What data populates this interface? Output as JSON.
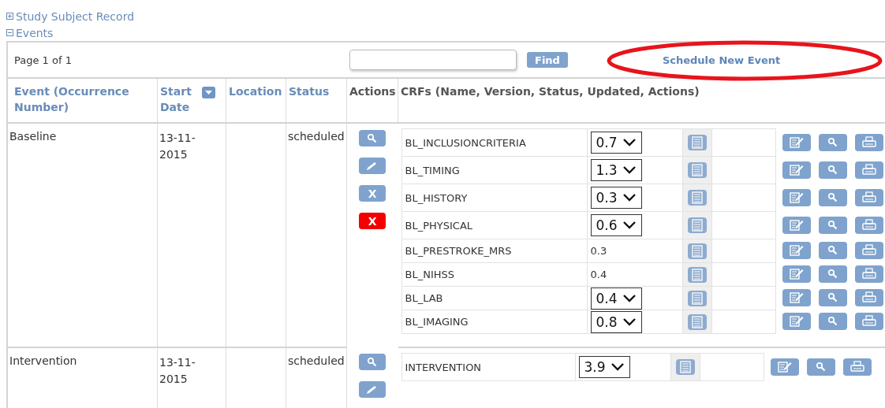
{
  "sections": [
    {
      "label": "Study Subject Record",
      "expanded": false
    },
    {
      "label": "Events",
      "expanded": true
    }
  ],
  "toolbar": {
    "page_info": "Page 1 of 1",
    "find_button": "Find",
    "schedule_link": "Schedule New Event"
  },
  "table": {
    "columns": [
      "Event (Occurrence Number)",
      "Start Date",
      "Location",
      "Status",
      "Actions",
      "CRFs (Name, Version, Status, Updated, Actions)"
    ],
    "rows": [
      {
        "event": "Baseline",
        "start_date": "13-11-2015",
        "status": "scheduled",
        "actions": [
          {
            "kind": "view"
          },
          {
            "kind": "edit"
          },
          {
            "kind": "remove",
            "label": "X"
          },
          {
            "kind": "delete",
            "label": "X"
          }
        ],
        "crfs": [
          {
            "name": "BL_INCLUSIONCRITERIA",
            "kind": "select",
            "version": "0.7"
          },
          {
            "name": "BL_TIMING",
            "kind": "select",
            "version": "1.3"
          },
          {
            "name": "BL_HISTORY",
            "kind": "select",
            "version": "0.3"
          },
          {
            "name": "BL_PHYSICAL",
            "kind": "select",
            "version": "0.6"
          },
          {
            "name": "BL_PRESTROKE_MRS",
            "kind": "text",
            "version": "0.3"
          },
          {
            "name": "BL_NIHSS",
            "kind": "text",
            "version": "0.4"
          },
          {
            "name": "BL_LAB",
            "kind": "select",
            "version": "0.4"
          },
          {
            "name": "BL_IMAGING",
            "kind": "select",
            "version": "0.8"
          }
        ]
      },
      {
        "event": "Intervention",
        "start_date": "13-11-2015",
        "status": "scheduled",
        "actions": [
          {
            "kind": "view"
          },
          {
            "kind": "edit"
          }
        ],
        "crfs": [
          {
            "name": "INTERVENTION",
            "kind": "select",
            "version": "3.9"
          }
        ]
      }
    ]
  }
}
